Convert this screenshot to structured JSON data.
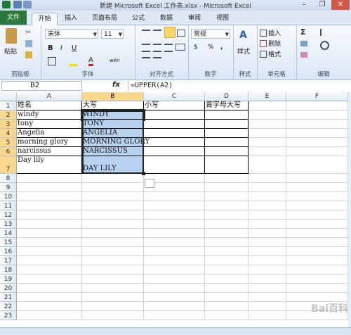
{
  "window": {
    "title": "新建 Microsoft Excel 工作表.xlsx - Microsoft Excel",
    "minimize": "–",
    "restore": "❐",
    "close": "✕"
  },
  "tabs": [
    "文件",
    "开始",
    "插入",
    "页面布局",
    "公式",
    "数据",
    "审阅",
    "视图"
  ],
  "ribbon": {
    "clipboard": {
      "name": "剪贴板",
      "paste": "粘贴"
    },
    "font": {
      "name": "字体",
      "font_name": "宋体",
      "font_size": "11",
      "bold": "B",
      "italic": "I",
      "underline": "U",
      "font_color_glyph": "A",
      "phonetic": "wén"
    },
    "alignment": {
      "name": "对齐方式"
    },
    "number": {
      "name": "数字",
      "format": "常规",
      "percent": "%",
      "comma": ",",
      "currency": "$"
    },
    "styles": {
      "name": "样式",
      "label": "样式"
    },
    "cells": {
      "name": "单元格",
      "insert": "插入",
      "delete": "删除",
      "format": "格式"
    },
    "editing": {
      "name": "编辑",
      "sum": "Σ"
    }
  },
  "formula_bar": {
    "name_box": "B2",
    "fx": "fx",
    "formula": "=UPPER(A2)"
  },
  "columns": [
    "A",
    "B",
    "C",
    "D",
    "E",
    "F"
  ],
  "rows": [
    "1",
    "2",
    "3",
    "4",
    "5",
    "6",
    "7",
    "8",
    "9",
    "10",
    "11",
    "12",
    "13",
    "14",
    "15",
    "16",
    "17",
    "18",
    "19",
    "20",
    "21",
    "22",
    "23"
  ],
  "sheet": {
    "A": [
      "姓名",
      "windy",
      "tony",
      "Angelia",
      "morning glory",
      "narcissus",
      "Day lily"
    ],
    "B": [
      "大写",
      "WINDY",
      "TONY",
      "ANGELIA",
      "MORNING GLORY",
      "NARCISSUS",
      "DAY LILY"
    ],
    "C1": "小写",
    "D1": "首字母大写"
  },
  "watermark": "Bai百科"
}
